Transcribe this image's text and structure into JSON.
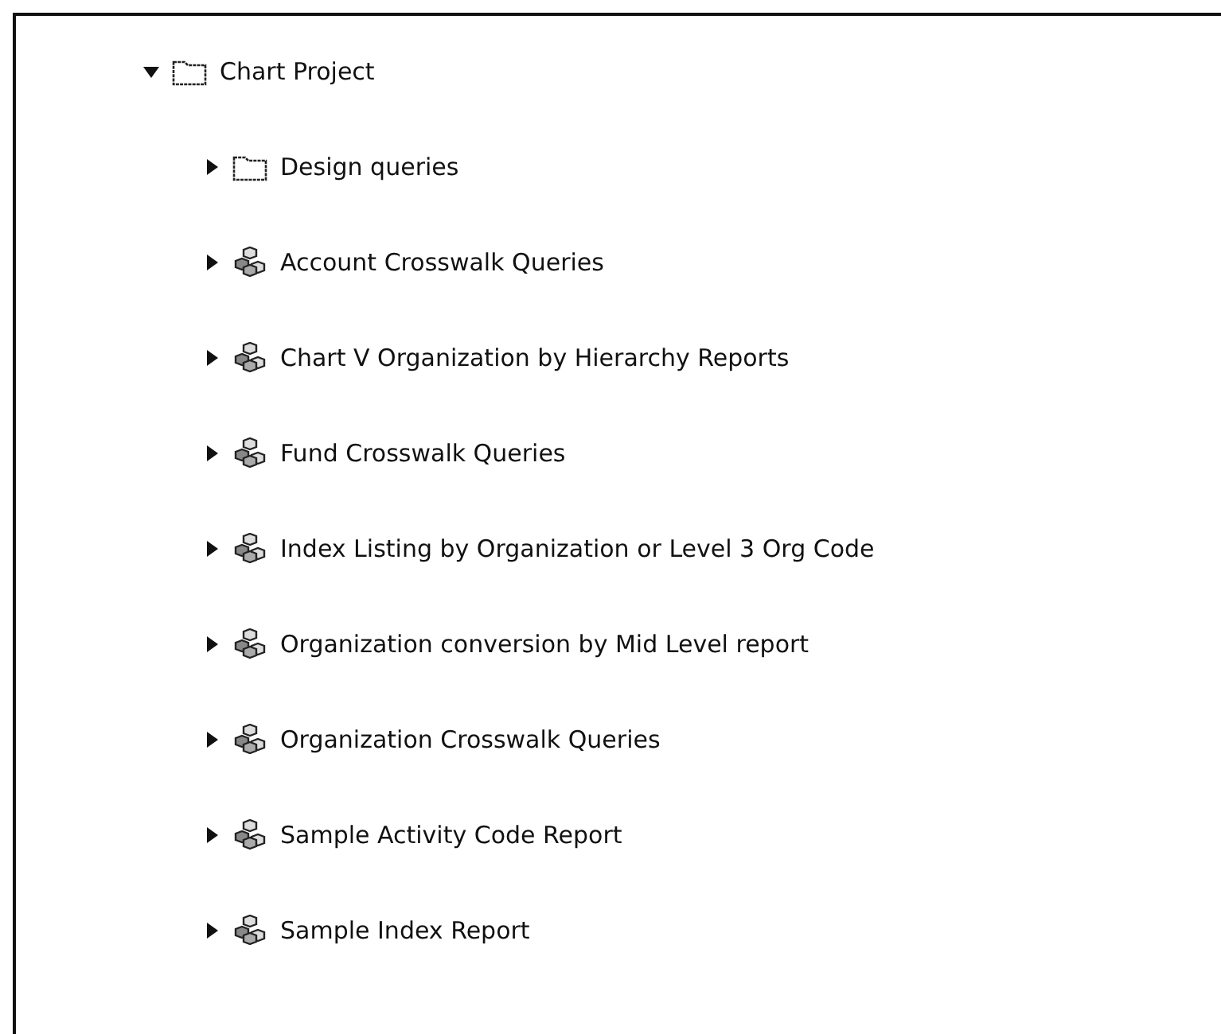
{
  "tree": [
    {
      "label": "Chart Project",
      "kind": "folder",
      "expanded": true,
      "children": [
        {
          "label": "Design queries",
          "kind": "folder",
          "expanded": false
        },
        {
          "label": "Account Crosswalk Queries",
          "kind": "query",
          "expanded": false
        },
        {
          "label": "Chart V Organization by Hierarchy Reports",
          "kind": "query",
          "expanded": false
        },
        {
          "label": "Fund Crosswalk Queries",
          "kind": "query",
          "expanded": false
        },
        {
          "label": "Index Listing by Organization or Level 3 Org Code",
          "kind": "query",
          "expanded": false
        },
        {
          "label": "Organization conversion by Mid Level report",
          "kind": "query",
          "expanded": false
        },
        {
          "label": "Organization Crosswalk Queries",
          "kind": "query",
          "expanded": false
        },
        {
          "label": "Sample Activity Code Report",
          "kind": "query",
          "expanded": false
        },
        {
          "label": "Sample Index Report",
          "kind": "query",
          "expanded": false
        }
      ]
    }
  ]
}
